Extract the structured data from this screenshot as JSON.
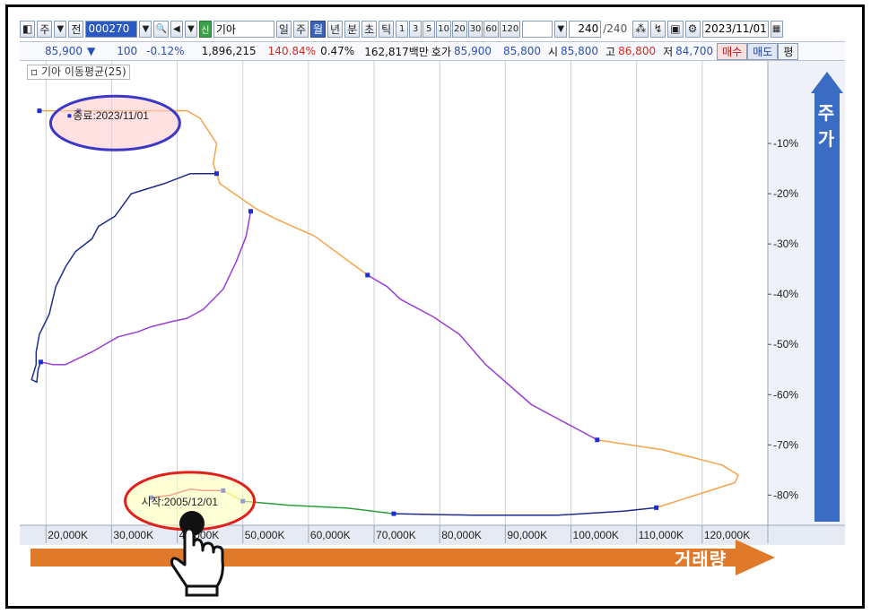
{
  "toolbar": {
    "market": "주",
    "prev": "전",
    "code": "000270",
    "badge": "신",
    "name": "기아",
    "periods": [
      {
        "label": "일",
        "selected": false
      },
      {
        "label": "주",
        "selected": false
      },
      {
        "label": "월",
        "selected": true
      },
      {
        "label": "년",
        "selected": false
      },
      {
        "label": "분",
        "selected": false
      },
      {
        "label": "초",
        "selected": false
      },
      {
        "label": "틱",
        "selected": false
      }
    ],
    "intervals": [
      "1",
      "3",
      "5",
      "10",
      "20",
      "30",
      "60",
      "120"
    ],
    "count": "240",
    "count_total": "/240",
    "date": "2023/11/01"
  },
  "quote": {
    "price": "85,900",
    "change_arrow": "▼",
    "change": "100",
    "change_pct": "-0.12%",
    "volume": "1,896,215",
    "volume_ratio": "140.84%",
    "turnover_pct": "0.47%",
    "amount": "162,817백만",
    "ask_label": "호가",
    "ask": "85,900",
    "bid": "85,800",
    "open_label": "시",
    "open": "85,800",
    "high_label": "고",
    "high": "86,800",
    "low_label": "저",
    "low": "84,700",
    "buy_label": "매수",
    "sell_label": "매도",
    "eval_label": "평"
  },
  "legend": "기아 이동평균(25)",
  "annotations": {
    "end": "종료:2023/11/01",
    "start": "시작:2005/12/01"
  },
  "overlay": {
    "y_arrow_label": "주가",
    "x_arrow_label": "거래량",
    "y_arrow_color": "#3b6cc4",
    "x_arrow_color": "#e0792a"
  },
  "chart_data": {
    "type": "line",
    "xlabel": "거래량",
    "ylabel": "주가",
    "x_tick_labels": [
      "20,000K",
      "30,000K",
      "40,000K",
      "50,000K",
      "60,000K",
      "70,000K",
      "80,000K",
      "90,000K",
      "100,000K",
      "110,000K",
      "120,000K"
    ],
    "y_tick_labels": [
      "-10%",
      "-20%",
      "-30%",
      "-40%",
      "-50%",
      "-60%",
      "-70%",
      "-80%"
    ],
    "x_range": [
      16000,
      130000
    ],
    "y_range": [
      -86,
      5
    ],
    "gridlines": "vertical",
    "series": [
      {
        "segment": 1,
        "color": "#e8375f",
        "points": [
          [
            37000,
            -82.0
          ],
          [
            41000,
            -81.0
          ],
          [
            44000,
            -78.5
          ],
          [
            47500,
            -79.0
          ]
        ]
      },
      {
        "segment": 2,
        "color": "#d8dc4a",
        "points": [
          [
            47500,
            -79.0
          ],
          [
            49000,
            -81.5
          ],
          [
            50500,
            -82.5
          ]
        ]
      },
      {
        "segment": 3,
        "color": "#2c9e3c",
        "points": [
          [
            50500,
            -82.5
          ],
          [
            60000,
            -82.8
          ],
          [
            74500,
            -84.5
          ]
        ]
      },
      {
        "segment": 4,
        "color": "#1e2d8a",
        "points": [
          [
            74500,
            -84.5
          ],
          [
            90000,
            -84.7
          ],
          [
            103000,
            -84.5
          ],
          [
            111500,
            -83.4
          ],
          [
            115000,
            -82.4
          ]
        ]
      },
      {
        "segment": 5,
        "color": "#f4a44c",
        "points": [
          [
            115000,
            -82.4
          ],
          [
            122000,
            -79.0
          ],
          [
            126000,
            -77.5
          ],
          [
            124000,
            -74.0
          ],
          [
            113000,
            -71.0
          ],
          [
            107000,
            -69.2
          ]
        ]
      },
      {
        "segment": 6,
        "color": "#9b3cd8",
        "points": [
          [
            107000,
            -69.2
          ],
          [
            95000,
            -61.0
          ],
          [
            88000,
            -50.0
          ],
          [
            85000,
            -46.5
          ],
          [
            78000,
            -43.0
          ],
          [
            73000,
            -39.0
          ],
          [
            70500,
            -36.5
          ]
        ]
      },
      {
        "segment": 7,
        "color": "#f4a44c",
        "points": [
          [
            70500,
            -36.5
          ],
          [
            63000,
            -29.0
          ],
          [
            57000,
            -25.0
          ],
          [
            52000,
            -23.0
          ],
          [
            47000,
            -18.5
          ],
          [
            45500,
            -13.0
          ],
          [
            44500,
            -5.0
          ],
          [
            42000,
            -4.5
          ]
        ]
      },
      {
        "segment": 8,
        "color": "#1e2d8a",
        "points": [
          [
            42000,
            -4.5
          ],
          [
            34000,
            -4.5
          ],
          [
            23000,
            -4.5
          ]
        ]
      },
      {
        "segment": 9,
        "color": "#f4a44c",
        "points": [
          [
            23000,
            -4.5
          ],
          [
            19000,
            -5.0
          ]
        ]
      },
      {
        "segment": 10,
        "color": "#ffffff",
        "points": []
      }
    ],
    "path": [
      {
        "points": [
          [
            36000,
            -80.5
          ],
          [
            39000,
            -80.0
          ],
          [
            42000,
            -78.8
          ],
          [
            44000,
            -79.1
          ],
          [
            47000,
            -79.1
          ]
        ],
        "color": "#e8375f"
      },
      {
        "points": [
          [
            47000,
            -79.1
          ],
          [
            49000,
            -80.5
          ],
          [
            50000,
            -81.2
          ]
        ],
        "color": "#d8dc4a"
      },
      {
        "points": [
          [
            50000,
            -81.2
          ],
          [
            57000,
            -82.0
          ],
          [
            66000,
            -82.6
          ],
          [
            73000,
            -83.7
          ]
        ],
        "color": "#2c9e3c"
      },
      {
        "points": [
          [
            73000,
            -83.7
          ],
          [
            85000,
            -84.0
          ],
          [
            98000,
            -84.0
          ],
          [
            108000,
            -83.2
          ],
          [
            113000,
            -82.5
          ]
        ],
        "color": "#1e2d8a"
      },
      {
        "points": [
          [
            113000,
            -82.5
          ],
          [
            119000,
            -80.0
          ],
          [
            125000,
            -77.5
          ],
          [
            125500,
            -76.0
          ],
          [
            123000,
            -74.0
          ],
          [
            114000,
            -71.0
          ],
          [
            104000,
            -69.0
          ]
        ],
        "color": "#f4a44c"
      },
      {
        "points": [
          [
            104000,
            -69.0
          ],
          [
            94000,
            -62.0
          ],
          [
            87000,
            -54.0
          ],
          [
            83000,
            -48.0
          ],
          [
            79000,
            -44.5
          ],
          [
            74000,
            -41.0
          ],
          [
            72000,
            -38.5
          ],
          [
            69000,
            -36.2
          ]
        ],
        "color": "#9b3cd8"
      },
      {
        "points": [
          [
            69000,
            -36.2
          ],
          [
            61000,
            -28.5
          ],
          [
            55000,
            -25.0
          ],
          [
            52000,
            -23.0
          ],
          [
            46500,
            -18.0
          ],
          [
            45500,
            -14.0
          ],
          [
            46000,
            -10.0
          ],
          [
            43500,
            -5.0
          ],
          [
            41500,
            -3.5
          ],
          [
            37000,
            -3.5
          ],
          [
            28500,
            -3.5
          ],
          [
            25000,
            -3.5
          ]
        ],
        "color": "#f4a44c"
      },
      {
        "points": [
          [
            25000,
            -3.5
          ],
          [
            23000,
            -3.5
          ],
          [
            19000,
            -3.5
          ]
        ],
        "color": "#f4a44c"
      },
      {
        "points": [
          [
            46000,
            -16.0
          ],
          [
            42000,
            -16.0
          ],
          [
            38000,
            -18.0
          ],
          [
            33000,
            -20.0
          ],
          [
            30500,
            -24.5
          ],
          [
            28000,
            -26.5
          ],
          [
            27000,
            -29.0
          ],
          [
            24500,
            -31.5
          ],
          [
            23000,
            -34.5
          ],
          [
            21500,
            -38.5
          ],
          [
            20500,
            -44.0
          ],
          [
            19000,
            -48.0
          ],
          [
            18500,
            -51.5
          ],
          [
            18500,
            -54.0
          ],
          [
            17800,
            -57.0
          ],
          [
            18600,
            -57.5
          ],
          [
            18800,
            -55.0
          ],
          [
            19200,
            -53.5
          ]
        ],
        "color": "#1e2d8a"
      },
      {
        "points": [
          [
            19200,
            -53.5
          ],
          [
            21000,
            -54.0
          ],
          [
            23000,
            -54.0
          ],
          [
            27000,
            -51.5
          ],
          [
            31000,
            -48.5
          ],
          [
            34000,
            -47.5
          ],
          [
            36000,
            -46.5
          ],
          [
            39000,
            -45.5
          ],
          [
            41500,
            -44.8
          ],
          [
            44000,
            -43.0
          ],
          [
            47000,
            -39.0
          ],
          [
            49000,
            -33.5
          ],
          [
            50500,
            -28.5
          ],
          [
            51200,
            -23.5
          ]
        ],
        "color": "#9b3cd8"
      }
    ],
    "point_count_note": ""
  }
}
